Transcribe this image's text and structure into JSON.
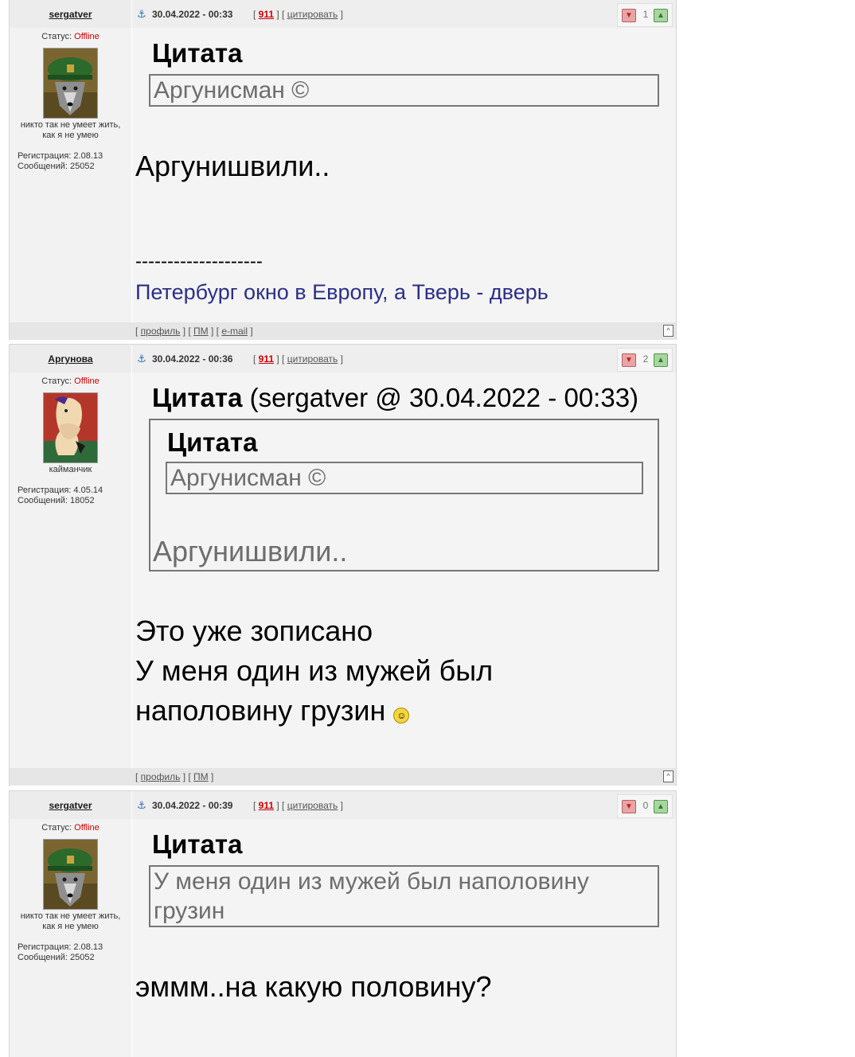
{
  "posts": [
    {
      "author": "sergatver",
      "date": "30.04.2022 - 00:33",
      "post_num": "911",
      "quote_link": "цитировать",
      "rating": "1",
      "status_label": "Статус:",
      "status_value": "Offline",
      "avatar_icon": "wolf-in-green-beret-avatar",
      "user_sig": "никто так не умеет жить, как я не умею",
      "reg": "Регистрация: 2.08.13",
      "messages": "Сообщений: 25052",
      "quote_label": "Цитата",
      "quote_text": "Аргунисман ©",
      "message": "Аргунишвили..",
      "sig_separator": "--------------------",
      "sig_link": "Петербург окно в Европу, а Тверь - дверь",
      "footer": {
        "profile": "профиль",
        "pm": "ПМ",
        "email": "e-mail",
        "top": "^"
      }
    },
    {
      "author": "Аргунова",
      "date": "30.04.2022 - 00:36",
      "post_num": "911",
      "quote_link": "цитировать",
      "rating": "2",
      "status_label": "Статус:",
      "status_value": "Offline",
      "avatar_icon": "painting-woman-avatar",
      "user_sig": "кайманчик",
      "reg": "Регистрация: 4.05.14",
      "messages": "Сообщений: 18052",
      "quote_label": "Цитата",
      "quote_meta": "(sergatver @ 30.04.2022 - 00:33)",
      "nested_quote_label": "Цитата",
      "nested_quote_text": "Аргунисман ©",
      "quote_text": "Аргунишвили..",
      "message_lines": [
        "Это уже зописано",
        "У меня один из мужей был",
        "наполовину грузин"
      ],
      "smile_icon": "smile-icon",
      "footer": {
        "profile": "профиль",
        "pm": "ПМ",
        "top": "^"
      }
    },
    {
      "author": "sergatver",
      "date": "30.04.2022 - 00:39",
      "post_num": "911",
      "quote_link": "цитировать",
      "rating": "0",
      "status_label": "Статус:",
      "status_value": "Offline",
      "avatar_icon": "wolf-in-green-beret-avatar",
      "user_sig": "никто так не умеет жить, как я не умею",
      "reg": "Регистрация: 2.08.13",
      "messages": "Сообщений: 25052",
      "quote_label": "Цитата",
      "quote_text": "У меня один из мужей был наполовину грузин",
      "message": "эммм..на какую половину?"
    }
  ],
  "colors": {
    "offline": "#cc0000",
    "signature_link": "#2c2f86",
    "post_number": "#cc0000"
  }
}
